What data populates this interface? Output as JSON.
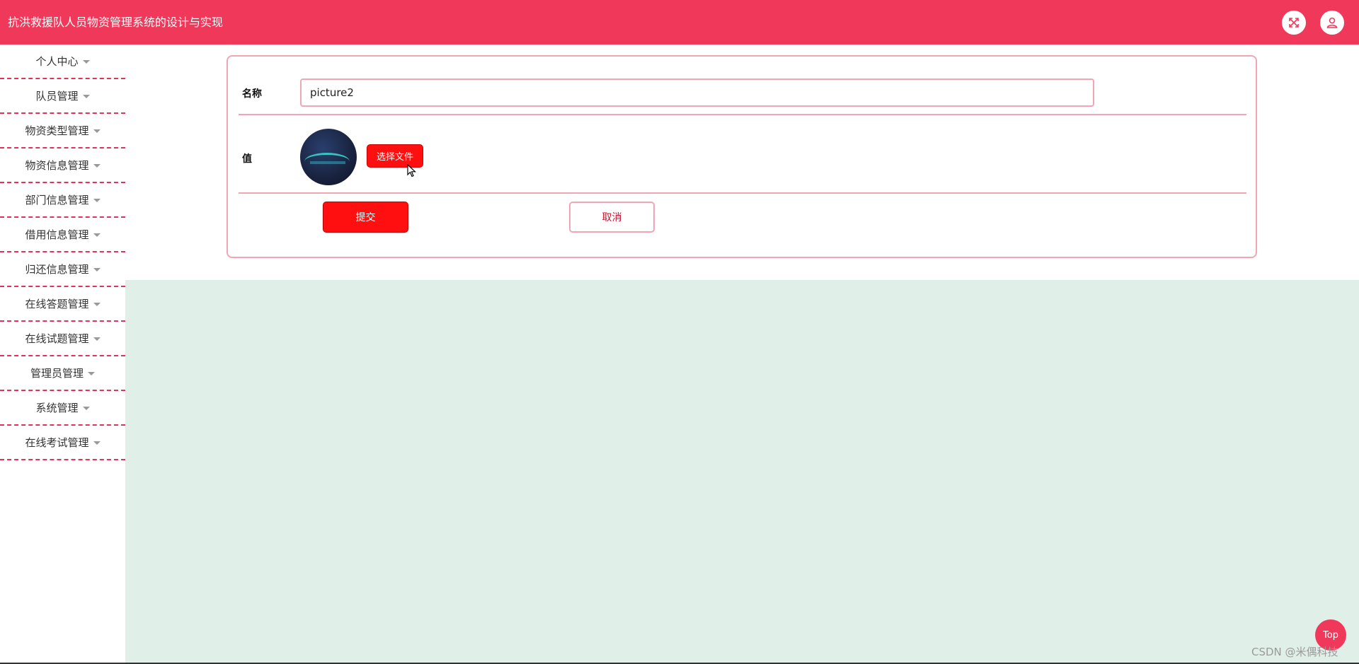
{
  "app": {
    "title": "抗洪救援队人员物资管理系统的设计与实现"
  },
  "header": {
    "fullscreen_icon": "fullscreen-icon",
    "user_icon": "user-icon",
    "accent_color": "#f0395a"
  },
  "sidebar": {
    "items": [
      {
        "label": "个人中心"
      },
      {
        "label": "队员管理"
      },
      {
        "label": "物资类型管理"
      },
      {
        "label": "物资信息管理"
      },
      {
        "label": "部门信息管理"
      },
      {
        "label": "借用信息管理"
      },
      {
        "label": "归还信息管理"
      },
      {
        "label": "在线答题管理"
      },
      {
        "label": "在线试题管理"
      },
      {
        "label": "管理员管理"
      },
      {
        "label": "系统管理"
      },
      {
        "label": "在线考试管理"
      }
    ]
  },
  "form": {
    "name_label": "名称",
    "name_value": "picture2",
    "value_label": "值",
    "upload_label": "选择文件",
    "submit_label": "提交",
    "cancel_label": "取消"
  },
  "footer": {
    "top_label": "Top",
    "watermark": "CSDN @米偶科技"
  }
}
